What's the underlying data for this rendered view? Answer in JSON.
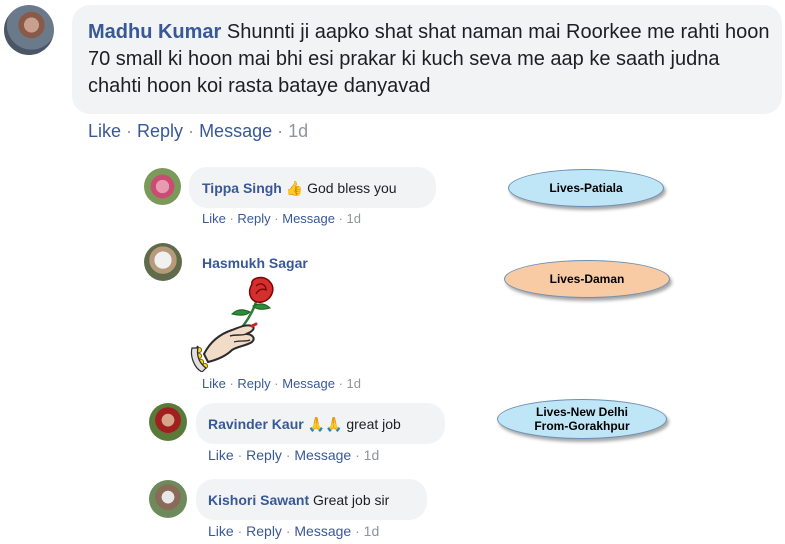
{
  "main_comment": {
    "author": "Madhu Kumar",
    "text": "Shunnti ji aapko shat shat naman mai Roorkee me rahti hoon 70 small ki hoon mai bhi esi prakar ki kuch seva me aap ke saath judna chahti hoon koi rasta bataye danyavad",
    "actions": {
      "like": "Like",
      "reply": "Reply",
      "message": "Message",
      "time": "1d"
    }
  },
  "replies": [
    {
      "author": "Tippa Singh",
      "text": "God bless you",
      "emoji": "👍",
      "actions": {
        "like": "Like",
        "reply": "Reply",
        "message": "Message",
        "time": "1d"
      }
    },
    {
      "author": "Hasmukh Sagar",
      "sticker": "hand-holding-rose",
      "actions": {
        "like": "Like",
        "reply": "Reply",
        "message": "Message",
        "time": "1d"
      }
    },
    {
      "author": "Ravinder Kaur",
      "text": "great job",
      "emoji": "🙏🙏",
      "actions": {
        "like": "Like",
        "reply": "Reply",
        "message": "Message",
        "time": "1d"
      }
    },
    {
      "author": "Kishori Sawant",
      "text": "Great job sir",
      "actions": {
        "like": "Like",
        "reply": "Reply",
        "message": "Message",
        "time": "1d"
      }
    }
  ],
  "annotations": [
    {
      "line1": "Lives-Patiala",
      "fill": "#bfe6f7"
    },
    {
      "line1": "Lives-Daman",
      "fill": "#f8cba5"
    },
    {
      "line1": "Lives-New Delhi",
      "line2": "From-Gorakhpur",
      "fill": "#bfe6f7"
    }
  ],
  "colors": {
    "name": "#385898",
    "meta": "#90949c",
    "bubble": "#f2f3f5"
  },
  "separator": " · "
}
